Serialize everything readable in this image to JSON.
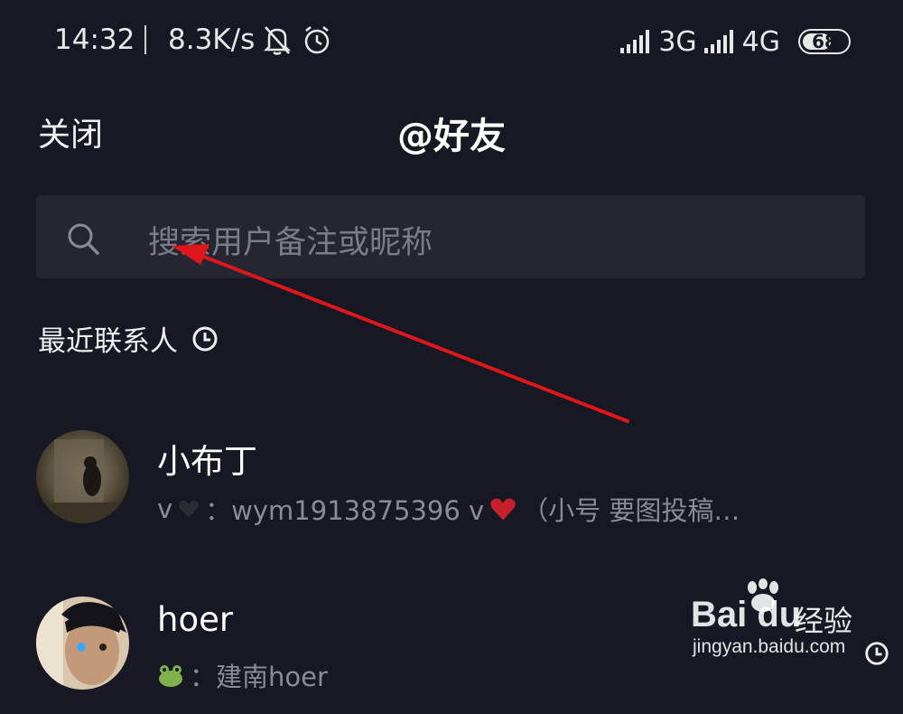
{
  "status_bar": {
    "time": "14:32",
    "net_speed": "8.3K/s",
    "network_1": "3G",
    "network_2": "4G",
    "battery": "68",
    "battery_level_percent": 68,
    "icons": [
      "bell-off-icon",
      "alarm-icon",
      "signal-icon",
      "signal-icon",
      "battery-icon"
    ]
  },
  "header": {
    "close_label": "关闭",
    "title": "@好友"
  },
  "search": {
    "placeholder": "搜索用户备注或昵称",
    "icon": "search-icon"
  },
  "recent": {
    "title": "最近联系人",
    "icon": "clock-icon"
  },
  "contacts": [
    {
      "name": "小布丁",
      "subtitle_prefix": "v",
      "subtitle_mid": "：wym1913875396  v",
      "subtitle_suffix": "（小号 要图投稿…",
      "emoji": [
        "black-heart-icon",
        "red-heart-icon"
      ]
    },
    {
      "name": "hoer",
      "subtitle": "：建南hoer",
      "emoji": [
        "frog-icon"
      ]
    }
  ],
  "watermark": {
    "logo": "Bai du",
    "chinese": "经验",
    "url": "jingyan.baidu.com"
  },
  "colors": {
    "background": "#161823",
    "search_bg": "#252632",
    "placeholder": "#7b7c86",
    "subtitle": "#8a8b94",
    "annotation_arrow": "#e0161b"
  }
}
